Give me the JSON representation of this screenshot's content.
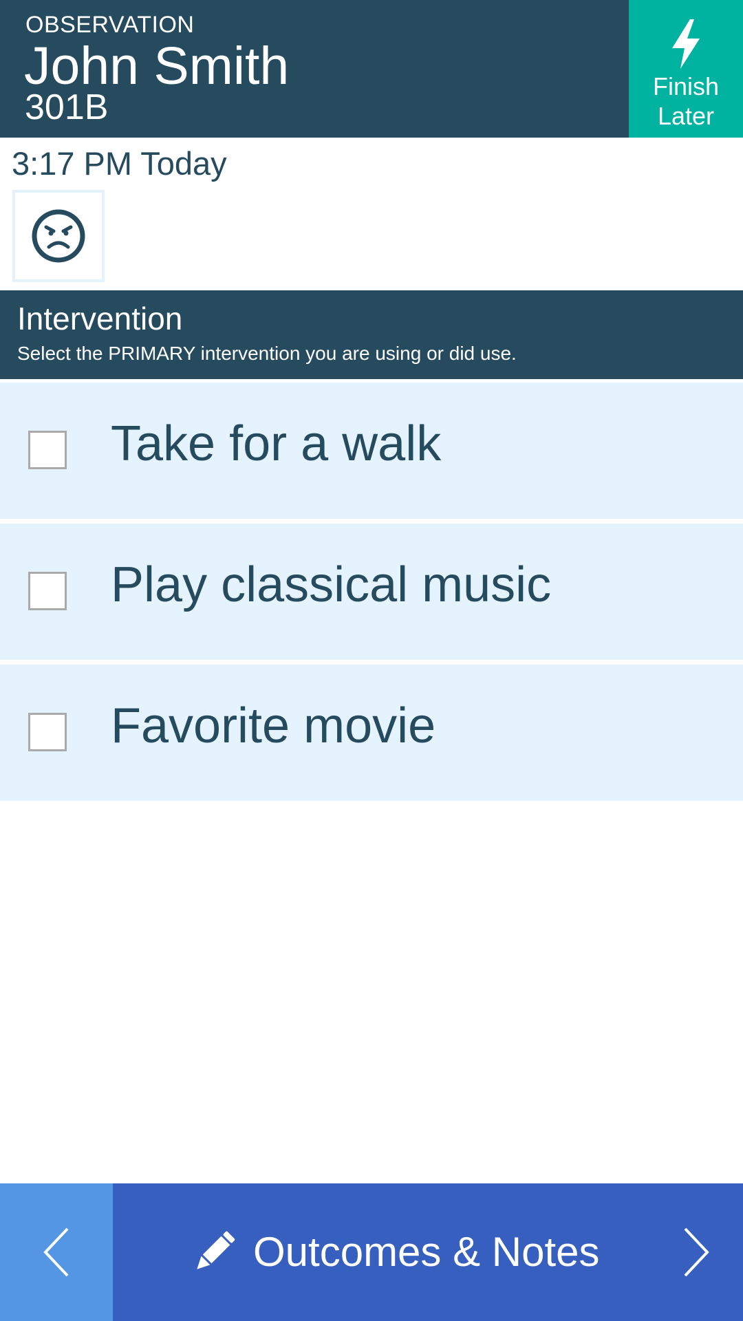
{
  "header": {
    "eyebrow": "OBSERVATION",
    "name": "John Smith",
    "room": "301B",
    "finish_later_line1": "Finish",
    "finish_later_line2": "Later",
    "finish_later_icon": "lightning-bolt-icon"
  },
  "observation": {
    "timestamp": "3:17 PM Today",
    "mood_icon": "angry-face-icon"
  },
  "intervention": {
    "title": "Intervention",
    "subtitle": "Select the PRIMARY intervention you are using or did use.",
    "options": [
      {
        "label": "Take for a walk",
        "checked": false
      },
      {
        "label": "Play classical music",
        "checked": false
      },
      {
        "label": "Favorite movie",
        "checked": false
      }
    ]
  },
  "footer": {
    "back_icon": "chevron-left-icon",
    "next_icon": "chevron-right-icon",
    "outcomes_icon": "pencil-icon",
    "outcomes_label": "Outcomes & Notes"
  },
  "colors": {
    "primary_dark": "#264a5e",
    "accent_teal": "#00b3a1",
    "option_bg": "#e4f3fd",
    "footer_blue": "#375fbf",
    "back_blue": "#5496e4"
  }
}
